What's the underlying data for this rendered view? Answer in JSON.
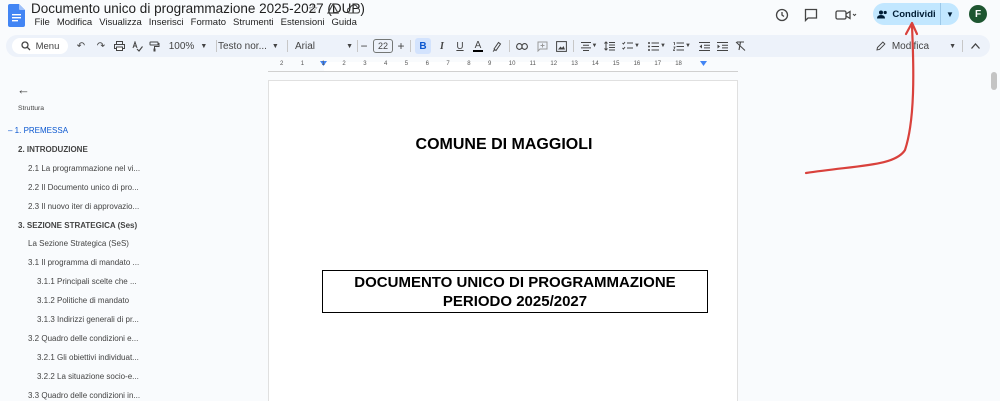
{
  "app": {
    "doc_title": "Documento unico di programmazione 2025-2027 (DUP)",
    "menus": [
      "File",
      "Modifica",
      "Visualizza",
      "Inserisci",
      "Formato",
      "Strumenti",
      "Estensioni",
      "Guida"
    ],
    "share_label": "Condividi",
    "avatar_letter": "F"
  },
  "toolbar": {
    "menu_label": "Menu",
    "zoom": "100%",
    "style": "Testo nor...",
    "font": "Arial",
    "font_size": "22",
    "mode": "Modifica"
  },
  "ruler": {
    "numbers": [
      "2",
      "1",
      "1",
      "2",
      "3",
      "4",
      "5",
      "6",
      "7",
      "8",
      "9",
      "10",
      "11",
      "12",
      "13",
      "14",
      "15",
      "16",
      "17",
      "18"
    ]
  },
  "outline": {
    "heading": "Struttura",
    "items": [
      {
        "label": "1. PREMESSA",
        "level": 1,
        "active": true
      },
      {
        "label": "2. INTRODUZIONE",
        "level": 1,
        "active": false
      },
      {
        "label": "2.1 La programmazione nel vi...",
        "level": 2,
        "active": false
      },
      {
        "label": "2.2 Il Documento unico di pro...",
        "level": 2,
        "active": false
      },
      {
        "label": "2.3 Il nuovo iter di approvazio...",
        "level": 2,
        "active": false
      },
      {
        "label": "3. SEZIONE STRATEGICA (Ses)",
        "level": 1,
        "active": false
      },
      {
        "label": "La Sezione Strategica (SeS)",
        "level": 2,
        "active": false
      },
      {
        "label": "3.1 Il programma di mandato ...",
        "level": 2,
        "active": false
      },
      {
        "label": "3.1.1 Principali scelte che ...",
        "level": 3,
        "active": false
      },
      {
        "label": "3.1.2 Politiche di mandato",
        "level": 3,
        "active": false
      },
      {
        "label": "3.1.3 Indirizzi generali di pr...",
        "level": 3,
        "active": false
      },
      {
        "label": "3.2 Quadro delle condizioni e...",
        "level": 2,
        "active": false
      },
      {
        "label": "3.2.1 Gli obiettivi individuat...",
        "level": 3,
        "active": false
      },
      {
        "label": "3.2.2 La situazione socio-e...",
        "level": 3,
        "active": false
      },
      {
        "label": "3.3 Quadro delle condizioni in...",
        "level": 2,
        "active": false
      }
    ]
  },
  "page": {
    "heading": "COMUNE DI MAGGIOLI",
    "title_line1": "DOCUMENTO UNICO DI PROGRAMMAZIONE",
    "title_line2": "PERIODO 2025/2027"
  },
  "colors": {
    "accent": "#0b57d0",
    "share_bg": "#c2e7ff",
    "annotation_arrow": "#d9413c"
  }
}
